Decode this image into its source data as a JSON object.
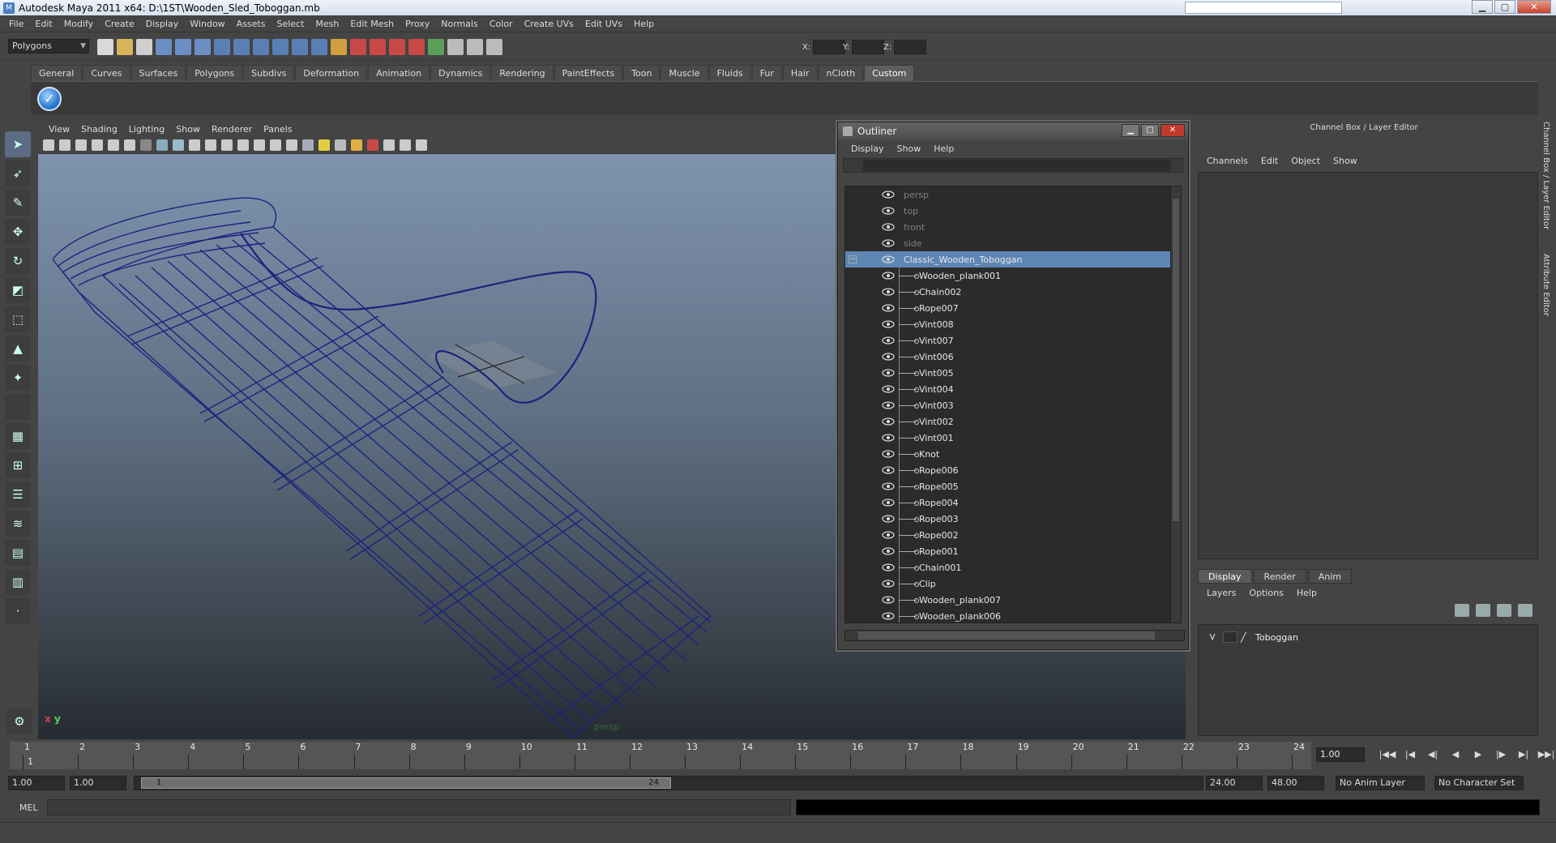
{
  "window": {
    "title": "Autodesk Maya 2011 x64: D:\\1ST\\Wooden_Sled_Toboggan.mb",
    "help_placeholder": ""
  },
  "menubar": [
    "File",
    "Edit",
    "Modify",
    "Create",
    "Display",
    "Window",
    "Assets",
    "Select",
    "Mesh",
    "Edit Mesh",
    "Proxy",
    "Normals",
    "Color",
    "Create UVs",
    "Edit UVs",
    "Help"
  ],
  "status_line": {
    "mode": "Polygons",
    "x_label": "X:",
    "y_label": "Y:",
    "z_label": "Z:"
  },
  "shelf_tabs": [
    "General",
    "Curves",
    "Surfaces",
    "Polygons",
    "Subdivs",
    "Deformation",
    "Animation",
    "Dynamics",
    "Rendering",
    "PaintEffects",
    "Toon",
    "Muscle",
    "Fluids",
    "Fur",
    "Hair",
    "nCloth",
    "Custom"
  ],
  "shelf_active": "Custom",
  "viewport": {
    "menu": [
      "View",
      "Shading",
      "Lighting",
      "Show",
      "Renderer",
      "Panels"
    ],
    "camera_label": "persp",
    "axis_x": "x",
    "axis_y": "y",
    "wire_color": "#1a237e"
  },
  "outliner": {
    "title": "Outliner",
    "menu": [
      "Display",
      "Show",
      "Help"
    ],
    "cameras": [
      "persp",
      "top",
      "front",
      "side"
    ],
    "group": "Classic_Wooden_Toboggan",
    "children": [
      "Wooden_plank001",
      "Chain002",
      "Rope007",
      "Vint008",
      "Vint007",
      "Vint006",
      "Vint005",
      "Vint004",
      "Vint003",
      "Vint002",
      "Vint001",
      "Knot",
      "Rope006",
      "Rope005",
      "Rope004",
      "Rope003",
      "Rope002",
      "Rope001",
      "Chain001",
      "Clip",
      "Wooden_plank007",
      "Wooden_plank006"
    ],
    "selection_color": "#5e86b4"
  },
  "channel_box": {
    "title": "Channel Box / Layer Editor",
    "menu": [
      "Channels",
      "Edit",
      "Object",
      "Show"
    ],
    "layer_tabs": [
      "Display",
      "Render",
      "Anim"
    ],
    "layer_menu": [
      "Layers",
      "Options",
      "Help"
    ],
    "layer": {
      "visible": "V",
      "name": "Toboggan"
    },
    "side_tabs": [
      "Channel Box / Layer Editor",
      "Attribute Editor"
    ]
  },
  "timeline": {
    "ticks": [
      "1",
      "2",
      "3",
      "4",
      "5",
      "6",
      "7",
      "8",
      "9",
      "10",
      "11",
      "12",
      "13",
      "14",
      "15",
      "16",
      "17",
      "18",
      "19",
      "20",
      "21",
      "22",
      "23",
      "24"
    ],
    "current": "1",
    "current_frame_field": "1.00"
  },
  "range": {
    "start": "1.00",
    "start2": "1.00",
    "slider_start": "1",
    "slider_end": "24",
    "end": "24.00",
    "end2": "48.00",
    "anim_layer": "No Anim Layer",
    "char_set": "No Character Set"
  },
  "mel": {
    "label": "MEL"
  }
}
